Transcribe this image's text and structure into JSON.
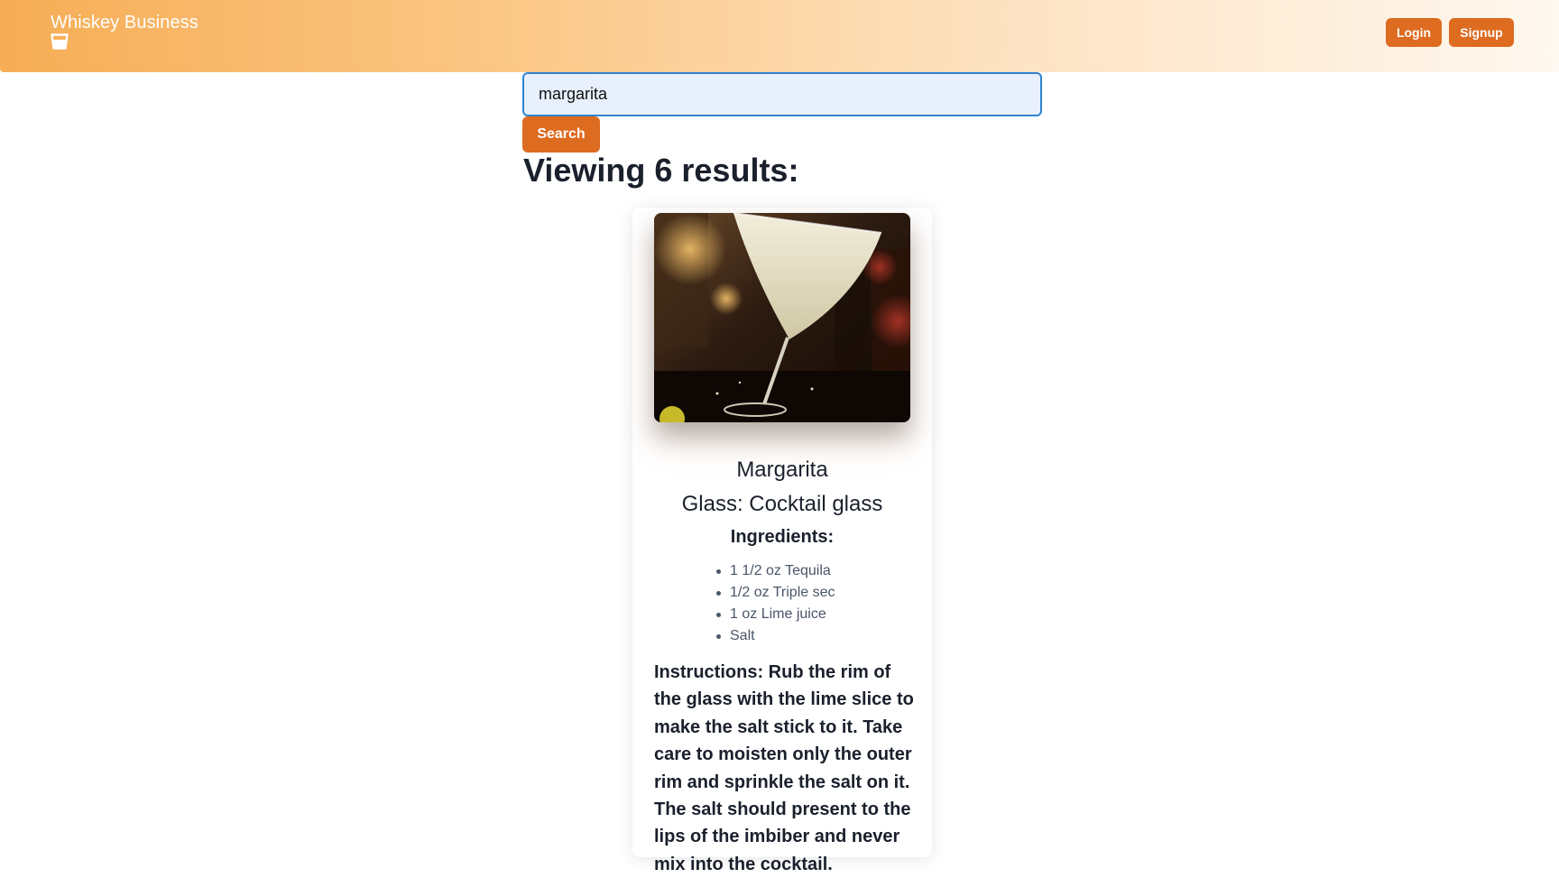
{
  "header": {
    "brand": "Whiskey Business",
    "brand_icon": "whiskey-glass-icon",
    "login_label": "Login",
    "signup_label": "Signup",
    "accent_color": "#dd6b20",
    "gradient_start": "#f6ad55"
  },
  "search": {
    "value": "margarita",
    "button_label": "Search"
  },
  "results": {
    "heading": "Viewing 6 results:"
  },
  "card": {
    "name": "Margarita",
    "glass": "Glass: Cocktail glass",
    "ingredients_title": "Ingredients:",
    "ingredients": [
      "1 1/2 oz Tequila",
      "1/2 oz Triple sec",
      "1 oz Lime juice",
      "Salt"
    ],
    "instructions": "Instructions: Rub the rim of the glass with the lime slice to make the salt stick to it. Take care to moisten only the outer rim and sprinkle the salt on it. The salt should present to the lips of the imbiber and never mix into the cocktail."
  }
}
